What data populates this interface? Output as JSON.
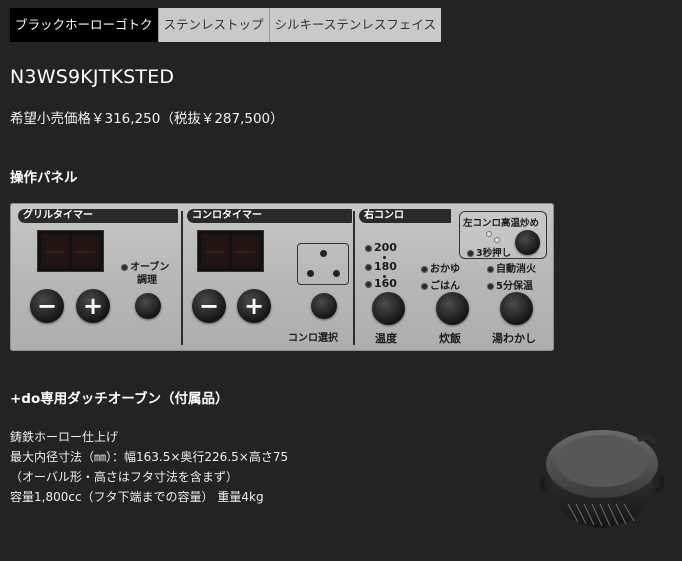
{
  "tabs": [
    {
      "label": "ブラックホーローゴトク",
      "active": true
    },
    {
      "label": "ステンレストップ",
      "active": false
    },
    {
      "label": "シルキーステンレスフェイス",
      "active": false
    }
  ],
  "model": "N3WS9KJTKSTED",
  "price": "希望小売価格￥316,250（税抜￥287,500）",
  "panel_heading": "操作パネル",
  "panel": {
    "grill_timer": "グリルタイマー",
    "konro_timer": "コンロタイマー",
    "right_konro": "右コンロ",
    "oven_line1": "オーブン",
    "oven_line2": "調理",
    "konro_select": "コンロ選択",
    "left_high": "左コンロ高温炒め",
    "hold3": "3秒押し",
    "t200": "200",
    "t180": "180",
    "t160": "160",
    "temp": "温度",
    "okayu": "おかゆ",
    "gohan": "ごはん",
    "rice": "炊飯",
    "auto_off": "自動消火",
    "keep5": "5分保温",
    "boil": "湯わかし",
    "minus": "−",
    "plus": "+"
  },
  "oven_heading": "+do専用ダッチオーブン（付属品）",
  "desc": [
    "鋳鉄ホーロー仕上げ",
    "最大内径寸法（㎜）：幅163.5×奥行226.5×高さ75",
    "（オーバル形・高さはフタ寸法を含まず）",
    "容量1,800cc（フタ下端までの容量） 重量4kg"
  ]
}
